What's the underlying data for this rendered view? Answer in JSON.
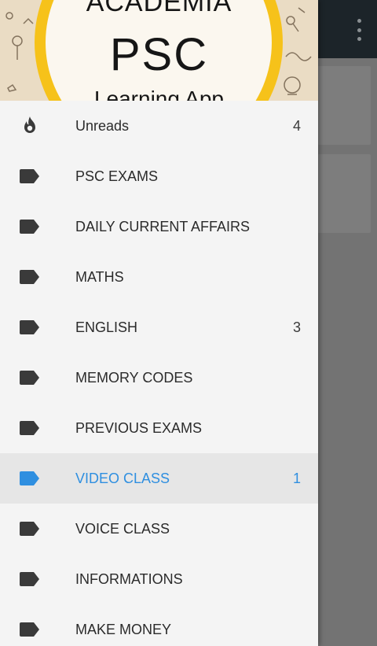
{
  "header": {
    "logo_top": "ACADEMIA",
    "logo_main": "PSC",
    "logo_bottom": "Learning App"
  },
  "menu": [
    {
      "label": "Unreads",
      "count": "4",
      "icon": "flame-icon"
    },
    {
      "label": "PSC EXAMS",
      "count": "",
      "icon": "tag-icon"
    },
    {
      "label": "DAILY CURRENT AFFAIRS",
      "count": "",
      "icon": "tag-icon"
    },
    {
      "label": "MATHS",
      "count": "",
      "icon": "tag-icon"
    },
    {
      "label": "ENGLISH",
      "count": "3",
      "icon": "tag-icon"
    },
    {
      "label": "MEMORY CODES",
      "count": "",
      "icon": "tag-icon"
    },
    {
      "label": "PREVIOUS EXAMS",
      "count": "",
      "icon": "tag-icon"
    },
    {
      "label": "VIDEO CLASS",
      "count": "1",
      "icon": "tag-icon",
      "active": true
    },
    {
      "label": "VOICE CLASS",
      "count": "",
      "icon": "tag-icon"
    },
    {
      "label": "INFORMATIONS",
      "count": "",
      "icon": "tag-icon"
    },
    {
      "label": "MAKE MONEY",
      "count": "",
      "icon": "tag-icon"
    }
  ],
  "colors": {
    "accent": "#2f8fe0",
    "icon": "#3a3a3a",
    "toolbar": "#1c2429",
    "logo_ring": "#f6c21a"
  }
}
